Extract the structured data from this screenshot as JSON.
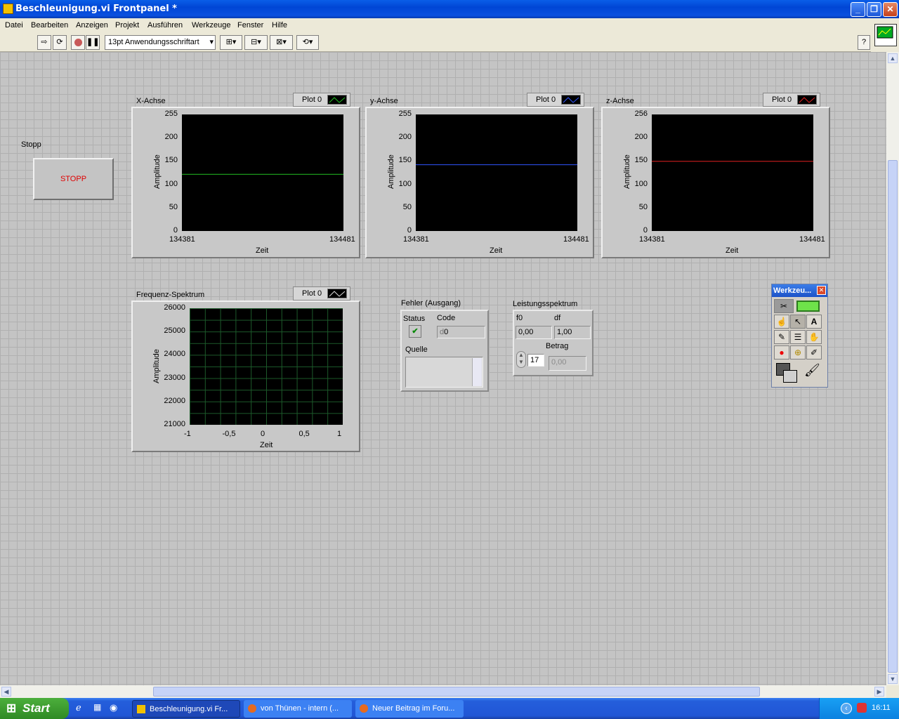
{
  "window": {
    "title": "Beschleunigung.vi Frontpanel *",
    "min": "_",
    "max": "❐",
    "close": "✕"
  },
  "menu": [
    "Datei",
    "Bearbeiten",
    "Anzeigen",
    "Projekt",
    "Ausführen",
    "Werkzeuge",
    "Fenster",
    "Hilfe"
  ],
  "toolbar": {
    "font_select": "13pt Anwendungsschriftart",
    "help": "?"
  },
  "stopp": {
    "label": "Stopp",
    "button_text": "STOPP"
  },
  "graphs": [
    {
      "title": "X-Achse",
      "plot": "Plot 0",
      "color": "#22c022",
      "yticks": [
        "255",
        "200",
        "150",
        "100",
        "50",
        "0"
      ],
      "xmin": "134381",
      "xmax": "134481",
      "xlabel": "Zeit",
      "ylabel": "Amplitude"
    },
    {
      "title": "y-Achse",
      "plot": "Plot 0",
      "color": "#2f55ff",
      "yticks": [
        "255",
        "200",
        "150",
        "100",
        "50",
        "0"
      ],
      "xmin": "134381",
      "xmax": "134481",
      "xlabel": "Zeit",
      "ylabel": "Amplitude"
    },
    {
      "title": "z-Achse",
      "plot": "Plot 0",
      "color": "#e02020",
      "yticks": [
        "256",
        "200",
        "150",
        "100",
        "50",
        "0"
      ],
      "xmin": "134381",
      "xmax": "134481",
      "xlabel": "Zeit",
      "ylabel": "Amplitude"
    }
  ],
  "spectrum": {
    "title": "Frequenz-Spektrum",
    "plot": "Plot 0",
    "yticks": [
      "26000",
      "25000",
      "24000",
      "23000",
      "22000",
      "21000"
    ],
    "xticks": [
      "-1",
      "-0,5",
      "0",
      "0,5",
      "1"
    ],
    "xlabel": "Zeit",
    "ylabel": "Amplitude"
  },
  "error_cluster": {
    "title": "Fehler (Ausgang)",
    "status_label": "Status",
    "status_mark": "✔",
    "code_label": "Code",
    "code_value": "0",
    "code_prefix": "d",
    "source_label": "Quelle",
    "source_value": ""
  },
  "power_spectrum": {
    "title": "Leistungsspektrum",
    "f0_label": "f0",
    "f0_value": "0,00",
    "df_label": "df",
    "df_value": "1,00",
    "betrag_label": "Betrag",
    "index_value": "17",
    "betrag_value": "0,00"
  },
  "tools_palette": {
    "title": "Werkzeu...",
    "close": "✕"
  },
  "taskbar": {
    "start": "Start",
    "tasks": [
      "Beschleunigung.vi Fr...",
      "von Thünen - intern (...",
      "Neuer Beitrag im Foru..."
    ],
    "lang": "DE",
    "clock": "16:11"
  },
  "colors": {
    "graph_bg": "#000000",
    "spectrum_grid": "#1c5a2a",
    "stop_text": "#e00000"
  },
  "chart_data": [
    {
      "type": "line",
      "title": "X-Achse",
      "xlabel": "Zeit",
      "ylabel": "Amplitude",
      "xlim": [
        134381,
        134481
      ],
      "ylim": [
        0,
        255
      ],
      "series": [
        {
          "name": "Plot 0",
          "x": [
            134381,
            134481
          ],
          "y": [
            124,
            124
          ]
        }
      ]
    },
    {
      "type": "line",
      "title": "y-Achse",
      "xlabel": "Zeit",
      "ylabel": "Amplitude",
      "xlim": [
        134381,
        134481
      ],
      "ylim": [
        0,
        255
      ],
      "series": [
        {
          "name": "Plot 0",
          "x": [
            134381,
            134481
          ],
          "y": [
            145,
            145
          ]
        }
      ]
    },
    {
      "type": "line",
      "title": "z-Achse",
      "xlabel": "Zeit",
      "ylabel": "Amplitude",
      "xlim": [
        134381,
        134481
      ],
      "ylim": [
        0,
        256
      ],
      "series": [
        {
          "name": "Plot 0",
          "x": [
            134381,
            134481
          ],
          "y": [
            153,
            153
          ]
        }
      ]
    },
    {
      "type": "line",
      "title": "Frequenz-Spektrum",
      "xlabel": "Zeit",
      "ylabel": "Amplitude",
      "xlim": [
        -1,
        1
      ],
      "ylim": [
        21000,
        26000
      ],
      "grid": true,
      "series": [
        {
          "name": "Plot 0",
          "x": [],
          "y": []
        }
      ]
    }
  ]
}
